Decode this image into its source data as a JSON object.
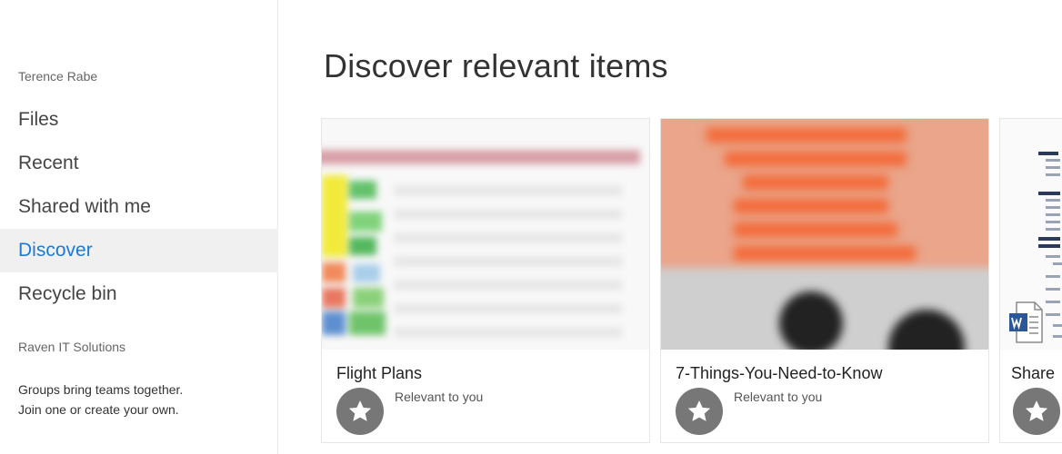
{
  "sidebar": {
    "owner": "Terence Rabe",
    "items": [
      {
        "label": "Files"
      },
      {
        "label": "Recent"
      },
      {
        "label": "Shared with me"
      },
      {
        "label": "Discover"
      },
      {
        "label": "Recycle bin"
      }
    ],
    "active_item": "Discover",
    "site_name": "Raven IT Solutions",
    "groups_line1": "Groups bring teams together.",
    "groups_line2": "Join one or create your own."
  },
  "main": {
    "title": "Discover relevant items",
    "cards": [
      {
        "name": "Flight Plans",
        "tag": "Relevant to you",
        "icon": "star-icon"
      },
      {
        "name": "7-Things-You-Need-to-Know",
        "tag": "Relevant to you",
        "icon": "star-icon"
      },
      {
        "name": "Share",
        "tag": "",
        "icon": "star-icon",
        "file_icon": "word-icon"
      }
    ]
  },
  "colors": {
    "accent": "#1b7ad4",
    "active_bg": "#f0f0f0",
    "star_bg": "#777777"
  }
}
